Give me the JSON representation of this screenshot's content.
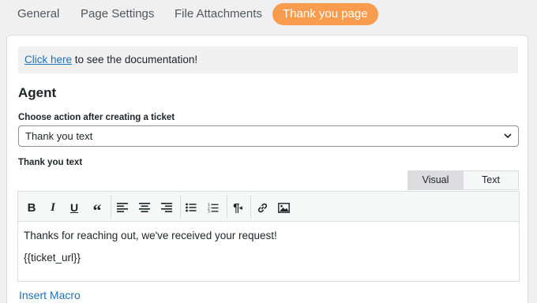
{
  "tabs": [
    {
      "label": "General"
    },
    {
      "label": "Page Settings"
    },
    {
      "label": "File Attachments"
    },
    {
      "label": "Thank you page"
    }
  ],
  "notice": {
    "link_text": "Click here",
    "rest_text": " to see the documentation!"
  },
  "section": {
    "title": "Agent"
  },
  "action_field": {
    "label": "Choose action after creating a ticket",
    "selected": "Thank you text"
  },
  "thank_you_field": {
    "label": "Thank you text"
  },
  "editor": {
    "view_tabs": {
      "visual": "Visual",
      "text": "Text"
    },
    "toolbar": [
      "bold-icon",
      "italic-icon",
      "underline-icon",
      "blockquote-icon",
      "align-left-icon",
      "align-center-icon",
      "align-right-icon",
      "bulleted-list-icon",
      "numbered-list-icon",
      "paragraph-direction-icon",
      "link-icon",
      "image-icon"
    ],
    "lines": [
      "Thanks for reaching out, we've received your request!",
      "{{ticket_url}}"
    ]
  },
  "insert_macro": "Insert Macro",
  "colors": {
    "accent_tab": "#f99c4d",
    "link": "#2271b1"
  }
}
